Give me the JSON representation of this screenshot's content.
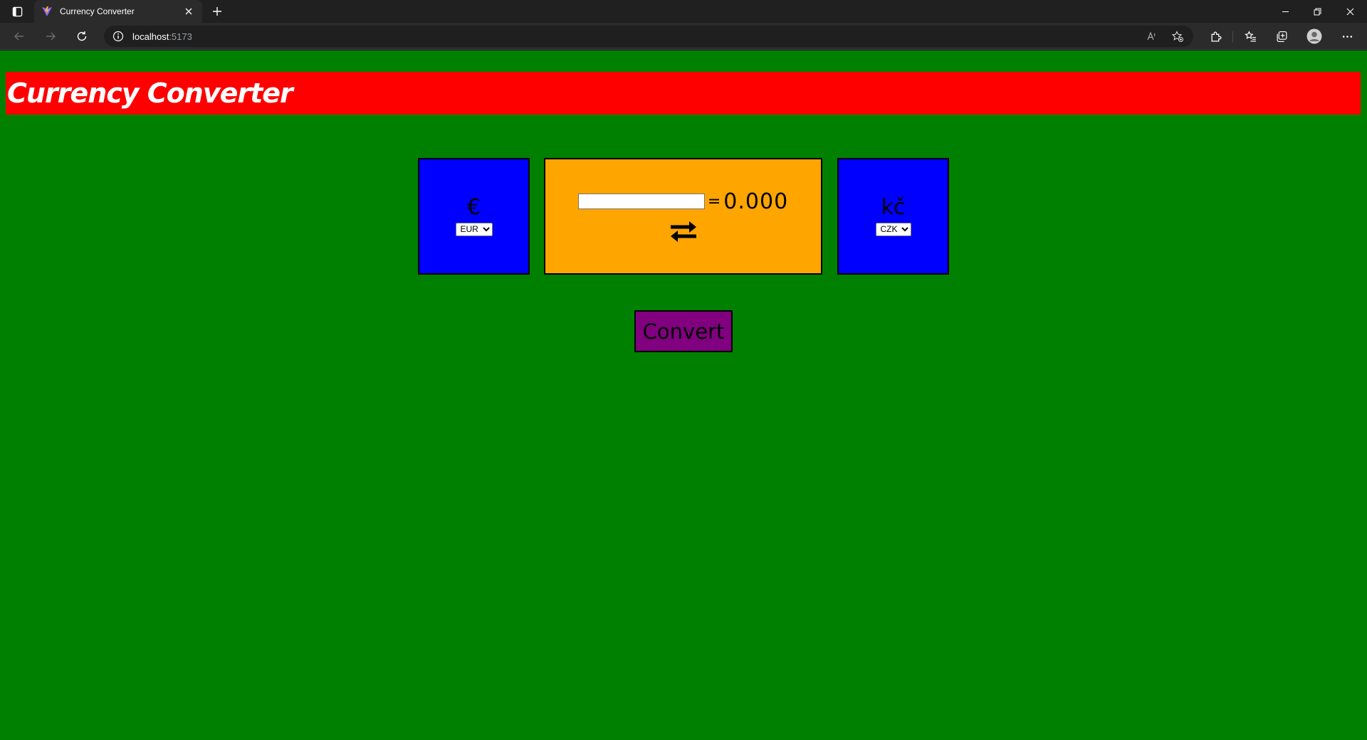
{
  "browser": {
    "tab": {
      "title": "Currency Converter"
    },
    "address": {
      "host": "localhost",
      "port": ":5173"
    },
    "icons": {
      "tab_actions": "tab-actions-icon",
      "favicon": "vite-logo-icon",
      "close_tab": "close-icon",
      "new_tab": "plus-icon",
      "back": "arrow-left-icon",
      "forward": "arrow-right-icon",
      "refresh": "refresh-icon",
      "site_info": "info-icon",
      "read_aloud": "read-aloud-icon",
      "add_favorite": "star-plus-icon",
      "extensions": "puzzle-icon",
      "favorites": "favorites-list-icon",
      "collections": "collections-icon",
      "profile": "profile-avatar-icon",
      "more": "ellipsis-icon",
      "minimize": "minimize-icon",
      "restore": "restore-icon",
      "close_window": "close-icon"
    }
  },
  "app": {
    "title": "Currency Converter",
    "from": {
      "symbol": "€",
      "selected": "EUR"
    },
    "to": {
      "symbol": "kč",
      "selected": "CZK"
    },
    "amount": {
      "value": "",
      "placeholder": ""
    },
    "equals": "=",
    "result": "0.000",
    "swap_icon": "swap-arrows-icon",
    "convert_label": "Convert"
  },
  "colors": {
    "page_background": "#008000",
    "header_background": "#ff0000",
    "currency_box": "#0000ff",
    "center_box": "#ffa500",
    "convert_button": "#800080"
  }
}
